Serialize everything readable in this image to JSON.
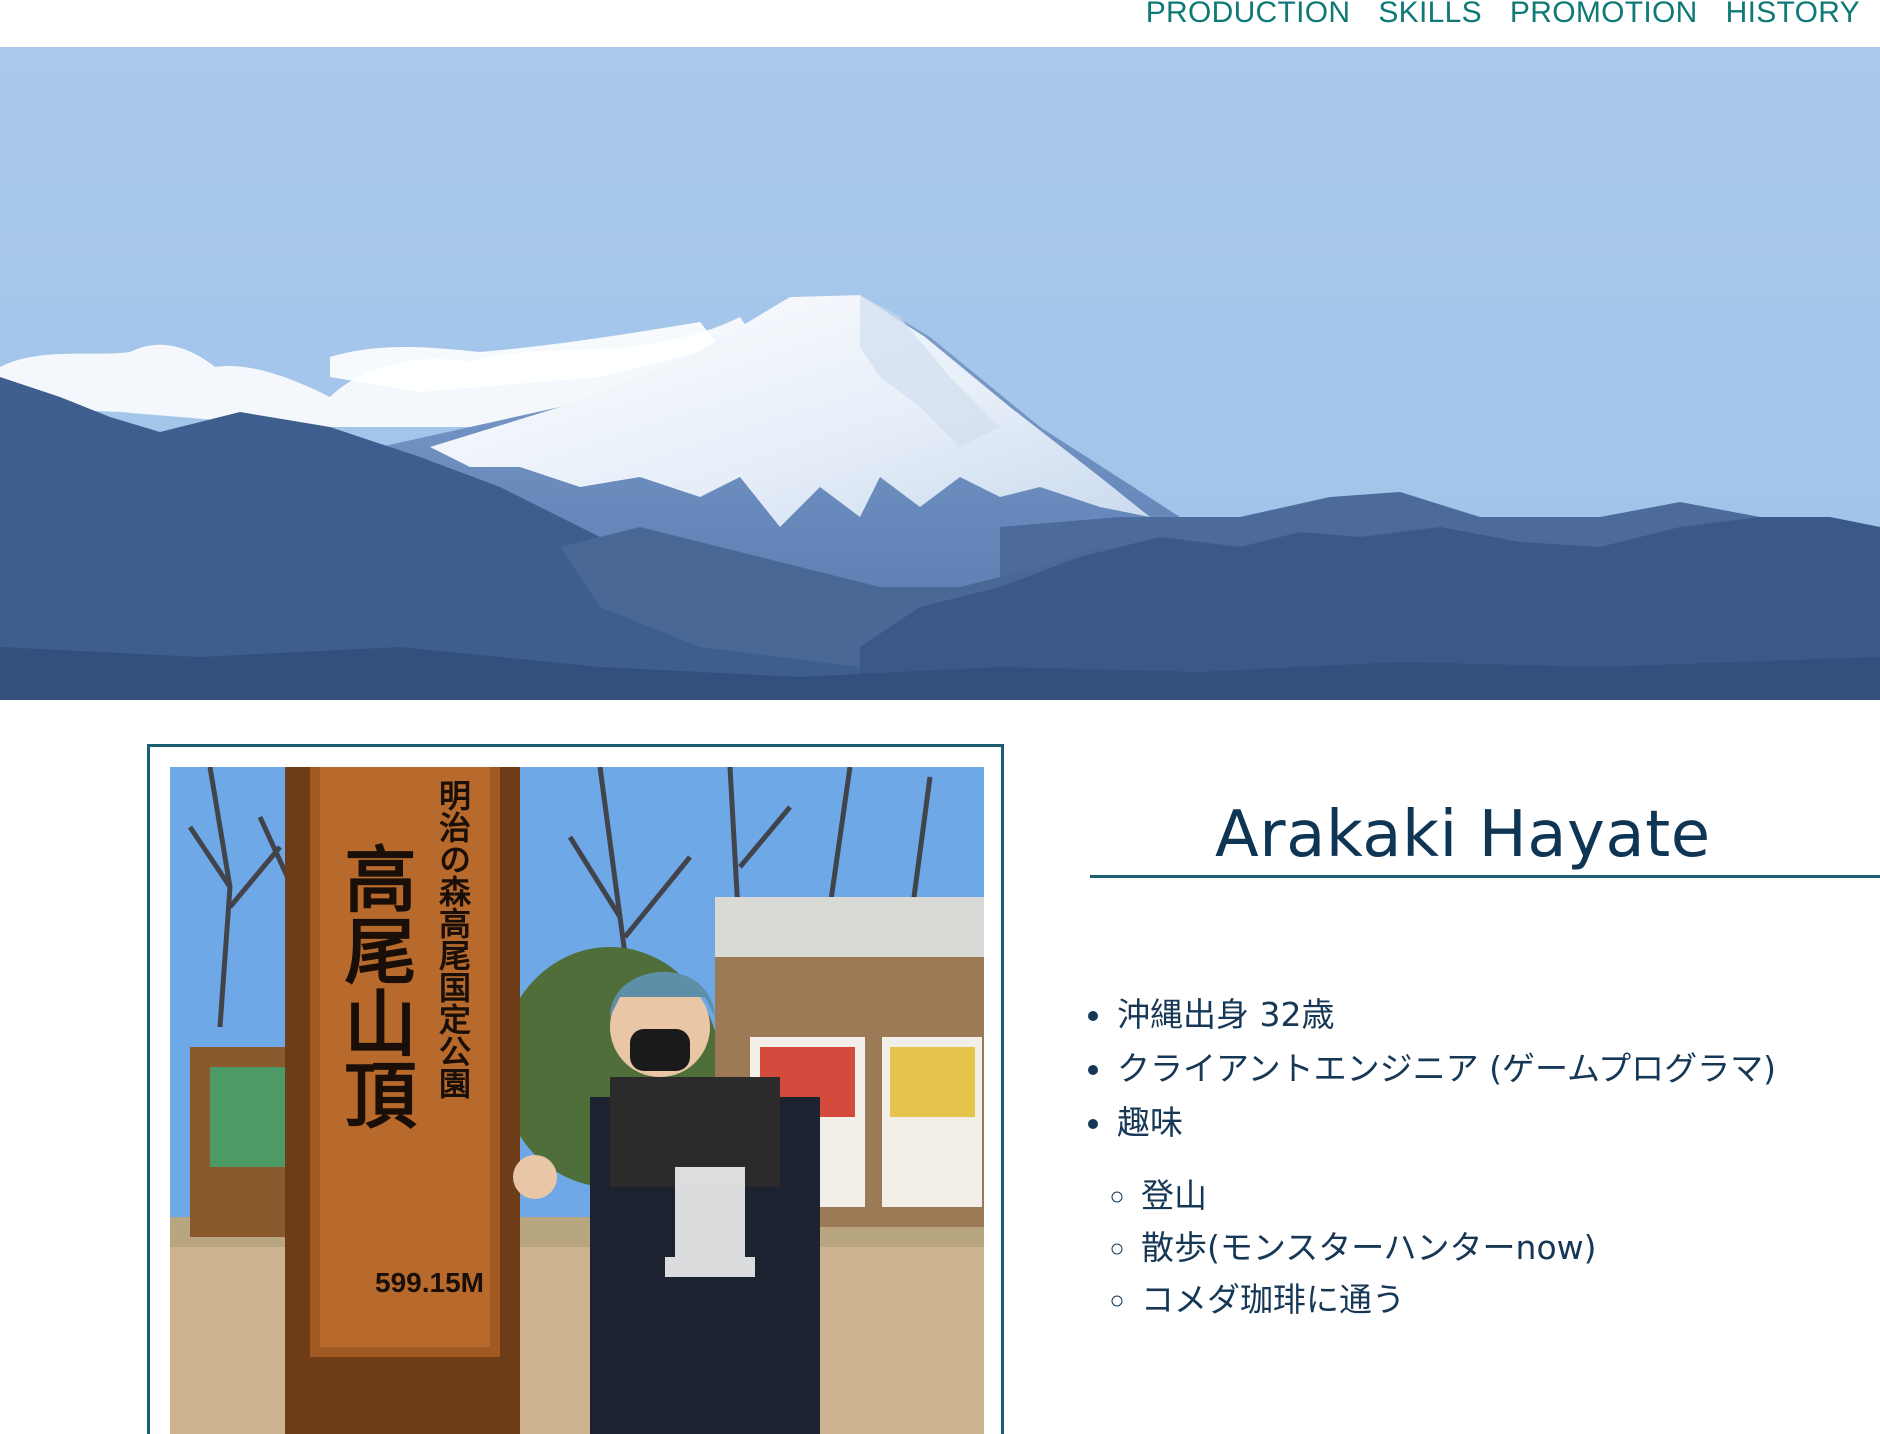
{
  "nav": {
    "items": [
      {
        "label": "PRODUCTION"
      },
      {
        "label": "SKILLS"
      },
      {
        "label": "PROMOTION"
      },
      {
        "label": "HISTORY"
      }
    ]
  },
  "hero": {
    "image": "mount-fuji-landscape"
  },
  "profile_photo": {
    "image": "person-at-mt-takao-summit",
    "sign": {
      "small_text": "明治の森高尾国定公園",
      "main_text": "高尾山頂",
      "elevation": "599.15M"
    }
  },
  "profile": {
    "name": "Arakaki Hayate",
    "facts": [
      "沖縄出身 32歳",
      "クライアントエンジニア (ゲームプログラマ)",
      "趣味"
    ],
    "hobbies": [
      "登山",
      "散歩(モンスターハンターnow)",
      "コメダ珈琲に通う"
    ]
  },
  "colors": {
    "accent": "#0f7a75",
    "frame": "#1b5f70",
    "text": "#163755"
  }
}
